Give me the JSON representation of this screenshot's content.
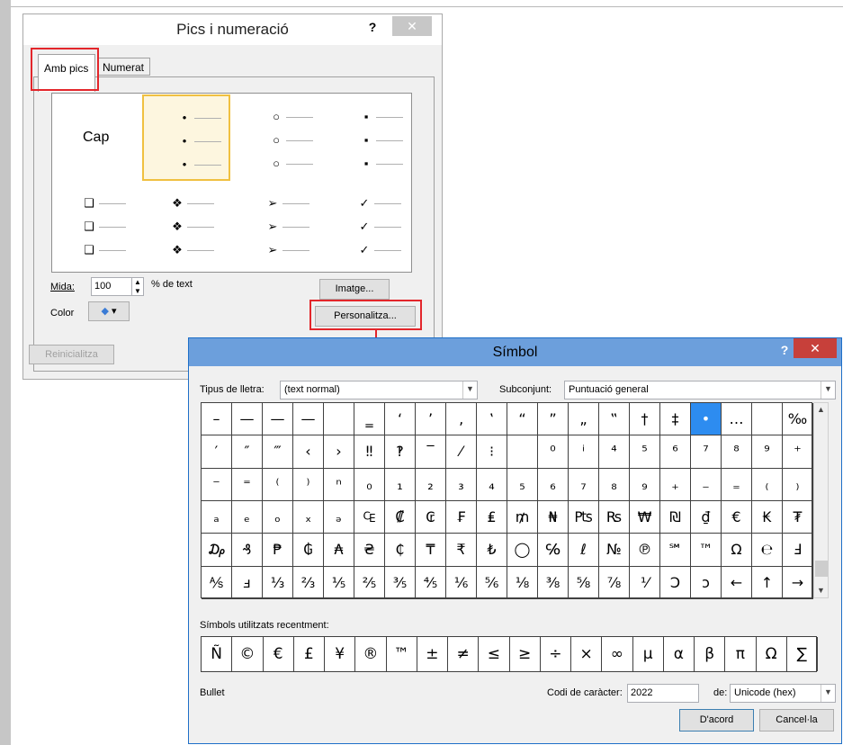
{
  "bullets_dialog": {
    "title": "Pics i numeració",
    "help": "?",
    "close": "✕",
    "tabs": [
      "Amb pics",
      "Numerat"
    ],
    "gallery": {
      "none_label": "Cap",
      "bullets": [
        "•",
        "○",
        "▪",
        "❑",
        "❖",
        "➢",
        "✓"
      ]
    },
    "size_label": "Mida:",
    "size_value": "100",
    "size_unit": "% de text",
    "color_label": "Color",
    "image_button": "Imatge...",
    "customize_button": "Personalitza...",
    "reset_button": "Reinicialitza"
  },
  "symbol_dialog": {
    "title": "Símbol",
    "help": "?",
    "close": "✕",
    "font_label": "Tipus de lletra:",
    "font_value": "(text normal)",
    "subset_label": "Subconjunt:",
    "subset_value": "Puntuació general",
    "grid": [
      [
        "–",
        "—",
        "—",
        "—",
        "",
        "‗",
        "‘",
        "’",
        "‚",
        "‛",
        "“",
        "”",
        "„",
        "‟",
        "†",
        "‡",
        "•",
        "…",
        "",
        "‰"
      ],
      [
        "′",
        "″",
        "‴",
        "‹",
        "›",
        "‼",
        "‽",
        "‾",
        "⁄",
        "⁝",
        "",
        "⁰",
        "ⁱ",
        "⁴",
        "⁵",
        "⁶",
        "⁷",
        "⁸",
        "⁹",
        "⁺"
      ],
      [
        "⁻",
        "⁼",
        "⁽",
        "⁾",
        "ⁿ",
        "₀",
        "₁",
        "₂",
        "₃",
        "₄",
        "₅",
        "₆",
        "₇",
        "₈",
        "₉",
        "₊",
        "₋",
        "₌",
        "₍",
        "₎"
      ],
      [
        "ₐ",
        "ₑ",
        "ₒ",
        "ₓ",
        "ₔ",
        "₠",
        "₡",
        "₢",
        "₣",
        "₤",
        "₥",
        "₦",
        "₧",
        "₨",
        "₩",
        "₪",
        "₫",
        "€",
        "₭",
        "₮"
      ],
      [
        "₯",
        "₰",
        "₱",
        "₲",
        "₳",
        "₴",
        "₵",
        "₸",
        "₹",
        "₺",
        "◯",
        "℅",
        "ℓ",
        "№",
        "℗",
        "℠",
        "™",
        "Ω",
        "℮",
        "Ⅎ"
      ],
      [
        "⅍",
        "ⅎ",
        "⅓",
        "⅔",
        "⅕",
        "⅖",
        "⅗",
        "⅘",
        "⅙",
        "⅚",
        "⅛",
        "⅜",
        "⅝",
        "⅞",
        "⅟",
        "Ↄ",
        "ↄ",
        "←",
        "↑",
        "→"
      ]
    ],
    "selected_symbol": "•",
    "recent_label": "Símbols utilitzats recentment:",
    "recent": [
      "Ñ",
      "©",
      "€",
      "£",
      "¥",
      "®",
      "™",
      "±",
      "≠",
      "≤",
      "≥",
      "÷",
      "×",
      "∞",
      "µ",
      "α",
      "β",
      "π",
      "Ω",
      "∑"
    ],
    "char_name": "Bullet",
    "code_label": "Codi de caràcter:",
    "code_value": "2022",
    "from_label": "de:",
    "from_value": "Unicode (hex)",
    "ok_button": "D'acord",
    "cancel_button": "Cancel·la"
  }
}
